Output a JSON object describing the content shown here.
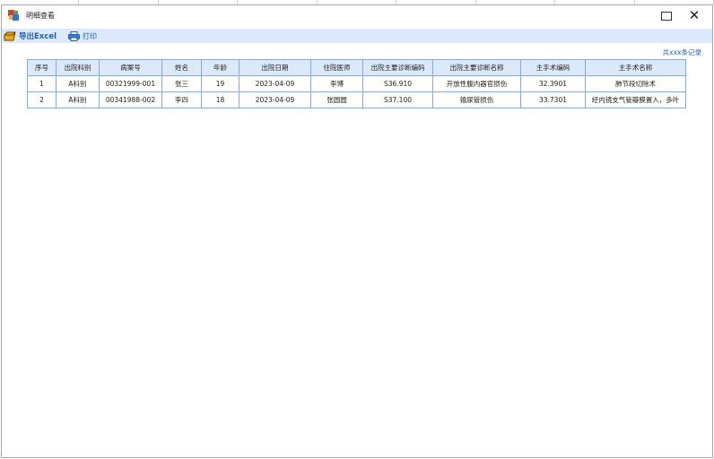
{
  "window": {
    "title": "明细查看"
  },
  "toolbar": {
    "export_label": "导出Excel",
    "print_label": "打印"
  },
  "summary": {
    "record_count": "共xxx条记录"
  },
  "table": {
    "headers": [
      "序号",
      "出院科别",
      "病案号",
      "姓名",
      "年龄",
      "出院日期",
      "住院医师",
      "出院主要诊断编码",
      "出院主要诊断名称",
      "主手术编码",
      "主手术名称"
    ],
    "rows": [
      [
        "1",
        "A科别",
        "00321999-001",
        "张三",
        "19",
        "2023-04-09",
        "李博",
        "S36.910",
        "开放性腹内器官损伤",
        "32.3901",
        "肺节段切除术"
      ],
      [
        "2",
        "A科别",
        "00341988-002",
        "李四",
        "18",
        "2023-04-09",
        "张圆圆",
        "S37.100",
        "输尿管损伤",
        "33.7301",
        "经内镜支气管瓣膜置入，多叶"
      ]
    ]
  },
  "colors": {
    "accent": "#1e5fb0",
    "header_bg": "#dbe9fa",
    "border": "#8fa8c8"
  }
}
